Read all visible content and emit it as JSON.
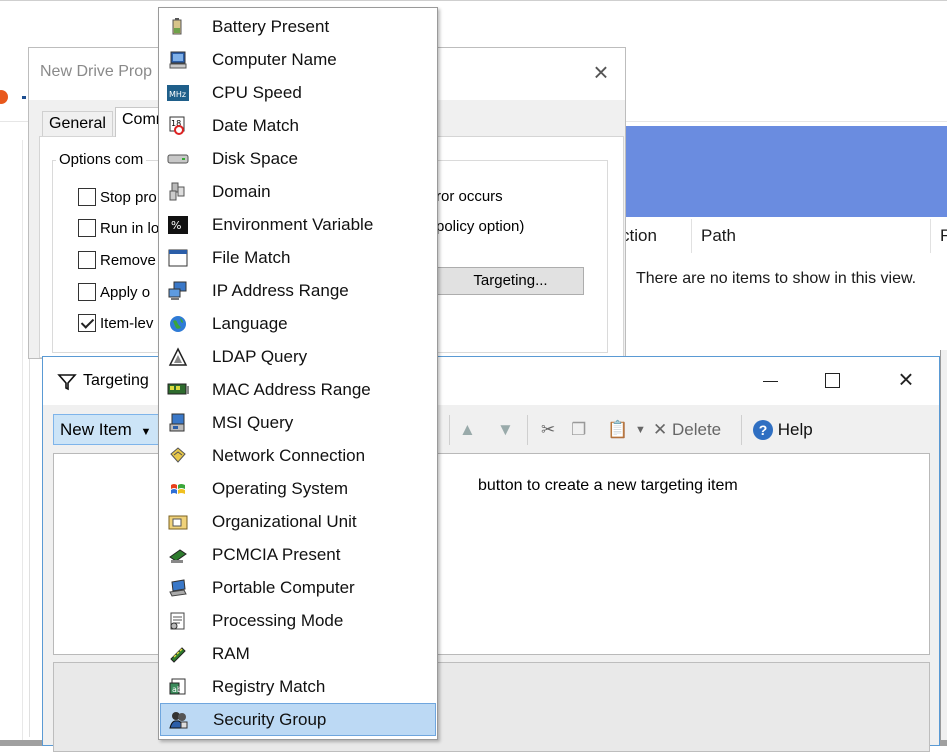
{
  "background": {
    "list_headers": [
      "ction",
      "Path",
      "F"
    ],
    "empty_text": "There are no items to show in this view."
  },
  "drive_dialog": {
    "title": "New Drive Prop",
    "tabs": [
      "General",
      "Comm"
    ],
    "group_label": "Options com",
    "options": [
      {
        "label": "Stop pro",
        "checked": false
      },
      {
        "label": "Run in lo",
        "checked": false
      },
      {
        "label": "Remove",
        "checked": false
      },
      {
        "label": "Apply o",
        "checked": false
      },
      {
        "label": "Item-lev",
        "checked": true
      }
    ],
    "option_tail_1": "ror occurs",
    "option_tail_2": "policy option)",
    "targeting_button": "Targeting..."
  },
  "targeting_editor": {
    "title": "Targeting",
    "new_item_label": "New Item",
    "delete_label": "Delete",
    "help_label": "Help",
    "hint": "button to create a new targeting item"
  },
  "menu": {
    "items": [
      {
        "label": "Battery Present",
        "icon": "battery-icon"
      },
      {
        "label": "Computer Name",
        "icon": "computer-icon"
      },
      {
        "label": "CPU Speed",
        "icon": "mhz-icon"
      },
      {
        "label": "Date Match",
        "icon": "calendar-icon"
      },
      {
        "label": "Disk Space",
        "icon": "disk-icon"
      },
      {
        "label": "Domain",
        "icon": "domain-icon"
      },
      {
        "label": "Environment Variable",
        "icon": "percent-icon"
      },
      {
        "label": "File Match",
        "icon": "file-window-icon"
      },
      {
        "label": "IP Address Range",
        "icon": "network-computers-icon"
      },
      {
        "label": "Language",
        "icon": "globe-icon"
      },
      {
        "label": "LDAP Query",
        "icon": "ldap-icon"
      },
      {
        "label": "MAC Address Range",
        "icon": "nic-icon"
      },
      {
        "label": "MSI Query",
        "icon": "msi-icon"
      },
      {
        "label": "Network Connection",
        "icon": "network-connection-icon"
      },
      {
        "label": "Operating System",
        "icon": "windows-flag-icon"
      },
      {
        "label": "Organizational Unit",
        "icon": "ou-icon"
      },
      {
        "label": "PCMCIA Present",
        "icon": "pcmcia-icon"
      },
      {
        "label": "Portable Computer",
        "icon": "laptop-icon"
      },
      {
        "label": "Processing Mode",
        "icon": "processing-icon"
      },
      {
        "label": "RAM",
        "icon": "ram-icon"
      },
      {
        "label": "Registry Match",
        "icon": "registry-icon"
      },
      {
        "label": "Security Group",
        "icon": "security-group-icon",
        "highlighted": true
      }
    ]
  }
}
